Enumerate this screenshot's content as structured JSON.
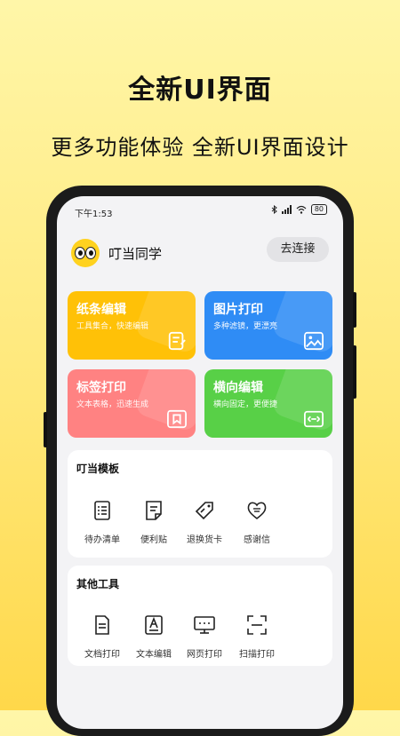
{
  "promo": {
    "headline": "全新UI界面",
    "subline": "更多功能体验 全新UI界面设计"
  },
  "statusbar": {
    "time": "下午1:53",
    "battery": "80"
  },
  "app": {
    "name": "叮当同学",
    "connect_label": "去连接"
  },
  "cards": [
    {
      "title": "纸条编辑",
      "desc": "工具集合，快速编辑",
      "color": "#ffc107"
    },
    {
      "title": "图片打印",
      "desc": "多种滤镜，更漂亮",
      "color": "#2f8cf5"
    },
    {
      "title": "标签打印",
      "desc": "文本表格，迅速生成",
      "color": "#ff8282"
    },
    {
      "title": "横向编辑",
      "desc": "横向固定，更便捷",
      "color": "#58d047"
    }
  ],
  "templates": {
    "title": "叮当模板",
    "items": [
      {
        "label": "待办清单",
        "icon": "checklist-icon"
      },
      {
        "label": "便利贴",
        "icon": "sticky-note-icon"
      },
      {
        "label": "退换货卡",
        "icon": "tag-icon"
      },
      {
        "label": "感谢信",
        "icon": "heart-icon"
      }
    ]
  },
  "tools": {
    "title": "其他工具",
    "items": [
      {
        "label": "文档打印",
        "icon": "document-icon"
      },
      {
        "label": "文本编辑",
        "icon": "text-edit-icon"
      },
      {
        "label": "网页打印",
        "icon": "web-monitor-icon"
      },
      {
        "label": "扫描打印",
        "icon": "scan-icon"
      }
    ]
  }
}
